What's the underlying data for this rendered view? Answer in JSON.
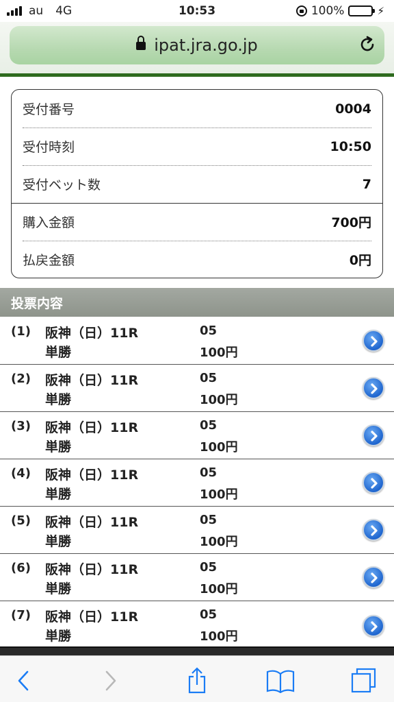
{
  "status_bar": {
    "carrier": "au",
    "network": "4G",
    "time": "10:53",
    "battery": "100%"
  },
  "browser": {
    "url": "ipat.jra.go.jp"
  },
  "summary": {
    "rows": [
      {
        "label": "受付番号",
        "value": "0004"
      },
      {
        "label": "受付時刻",
        "value": "10:50"
      },
      {
        "label": "受付ベット数",
        "value": "7"
      },
      {
        "label": "購入金額",
        "value": "700円"
      },
      {
        "label": "払戻金額",
        "value": "0円"
      }
    ]
  },
  "votes": {
    "title": "投票内容",
    "items": [
      {
        "num": "(1)",
        "race": "阪神（日）11R",
        "type": "単勝",
        "horse": "05",
        "amount": "100円"
      },
      {
        "num": "(2)",
        "race": "阪神（日）11R",
        "type": "単勝",
        "horse": "05",
        "amount": "100円"
      },
      {
        "num": "(3)",
        "race": "阪神（日）11R",
        "type": "単勝",
        "horse": "05",
        "amount": "100円"
      },
      {
        "num": "(4)",
        "race": "阪神（日）11R",
        "type": "単勝",
        "horse": "05",
        "amount": "100円"
      },
      {
        "num": "(5)",
        "race": "阪神（日）11R",
        "type": "単勝",
        "horse": "05",
        "amount": "100円"
      },
      {
        "num": "(6)",
        "race": "阪神（日）11R",
        "type": "単勝",
        "horse": "05",
        "amount": "100円"
      },
      {
        "num": "(7)",
        "race": "阪神（日）11R",
        "type": "単勝",
        "horse": "05",
        "amount": "100円"
      }
    ]
  },
  "colors": {
    "accent_green": "#2e6b1f",
    "detail_button_blue": "#1f66cf",
    "section_gray": "#8e948b",
    "ios_blue": "#1a7cf5"
  },
  "icons": {
    "detail": "chevron-right-circle-icon",
    "reload": "reload-icon",
    "lock": "lock-icon",
    "back": "back-icon",
    "forward": "forward-icon",
    "share": "share-icon",
    "bookmarks": "bookmarks-icon",
    "tabs": "tabs-icon"
  }
}
